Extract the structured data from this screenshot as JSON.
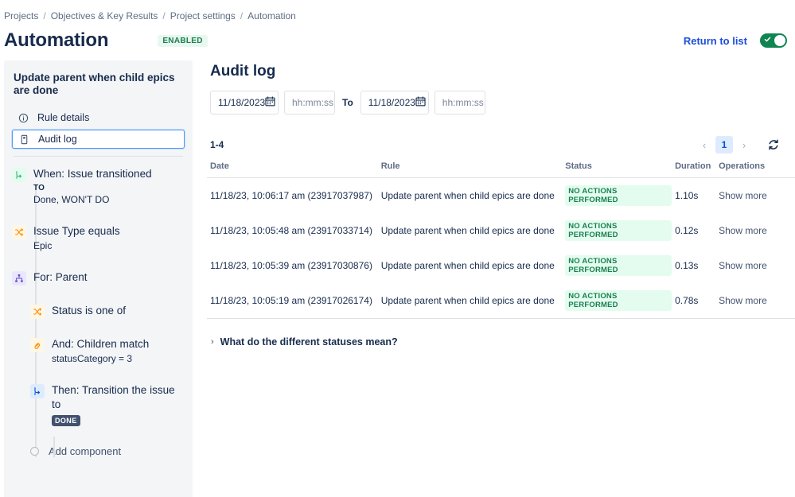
{
  "breadcrumb": {
    "items": [
      "Projects",
      "Objectives & Key Results",
      "Project settings",
      "Automation"
    ],
    "separator": "/"
  },
  "header": {
    "title": "Automation",
    "status_badge": "ENABLED",
    "return_link": "Return to list",
    "toggle_on": true,
    "toggle_color": "#0f8552"
  },
  "sidebar": {
    "rule_name": "Update parent when child epics are done",
    "nav": [
      {
        "label": "Rule details",
        "icon": "info-circle-icon",
        "selected": false
      },
      {
        "label": "Audit log",
        "icon": "document-icon",
        "selected": true
      }
    ],
    "components": [
      {
        "title": "When: Issue transitioned",
        "sub_label": "TO",
        "sub": "Done, WON'T DO",
        "icon": "transition-arrow-icon",
        "icon_bg": "#E3FCEF",
        "icon_color": "#36B37E",
        "indent": false
      },
      {
        "title": "Issue Type equals",
        "sub_label": "",
        "sub": "Epic",
        "icon": "shuffle-condition-icon",
        "icon_bg": "#FFF7E6",
        "icon_color": "#FF8B00",
        "indent": false
      },
      {
        "title": "For: Parent",
        "sub_label": "",
        "sub": "",
        "icon": "branch-hierarchy-icon",
        "icon_bg": "#EAE6FF",
        "icon_color": "#6554C0",
        "indent": false
      },
      {
        "title": "Status is one of",
        "sub_label": "",
        "sub": "",
        "icon": "shuffle-condition-icon",
        "icon_bg": "#FFF7E6",
        "icon_color": "#FF8B00",
        "indent": true
      },
      {
        "title": "And: Children match",
        "sub_label": "",
        "sub": "statusCategory = 3",
        "icon": "link-chain-icon",
        "icon_bg": "#FFF7E6",
        "icon_color": "#FF8B00",
        "indent": true
      },
      {
        "title": "Then: Transition the issue to",
        "sub_label": "",
        "sub": "",
        "lozenge": "DONE",
        "icon": "transition-arrow-icon",
        "icon_bg": "#DEEBFF",
        "icon_color": "#0052CC",
        "indent": true
      }
    ],
    "add_component": "Add component"
  },
  "audit": {
    "title": "Audit log",
    "filters": {
      "from_date": "11/18/2023",
      "from_time_placeholder": "hh:mm:ss",
      "to_label": "To",
      "to_date": "11/18/2023",
      "to_time_placeholder": "hh:mm:ss"
    },
    "count_text": "1-4",
    "pagination": {
      "prev": "‹",
      "current": "1",
      "next": "›"
    },
    "columns": [
      "Date",
      "Rule",
      "Status",
      "Duration",
      "Operations"
    ],
    "rows": [
      {
        "date": "11/18/23, 10:06:17 am (23917037987)",
        "rule": "Update parent when child epics are done",
        "status": "NO ACTIONS PERFORMED",
        "duration": "1.10s",
        "operation": "Show more"
      },
      {
        "date": "11/18/23, 10:05:48 am (23917033714)",
        "rule": "Update parent when child epics are done",
        "status": "NO ACTIONS PERFORMED",
        "duration": "0.12s",
        "operation": "Show more"
      },
      {
        "date": "11/18/23, 10:05:39 am (23917030876)",
        "rule": "Update parent when child epics are done",
        "status": "NO ACTIONS PERFORMED",
        "duration": "0.13s",
        "operation": "Show more"
      },
      {
        "date": "11/18/23, 10:05:19 am (23917026174)",
        "rule": "Update parent when child epics are done",
        "status": "NO ACTIONS PERFORMED",
        "duration": "0.78s",
        "operation": "Show more"
      }
    ],
    "statuses_expander": "What do the different statuses mean?",
    "statuses_chevron": "›",
    "status_badge_bg": "#E3FCEF",
    "status_badge_color": "#1a7f4e"
  }
}
